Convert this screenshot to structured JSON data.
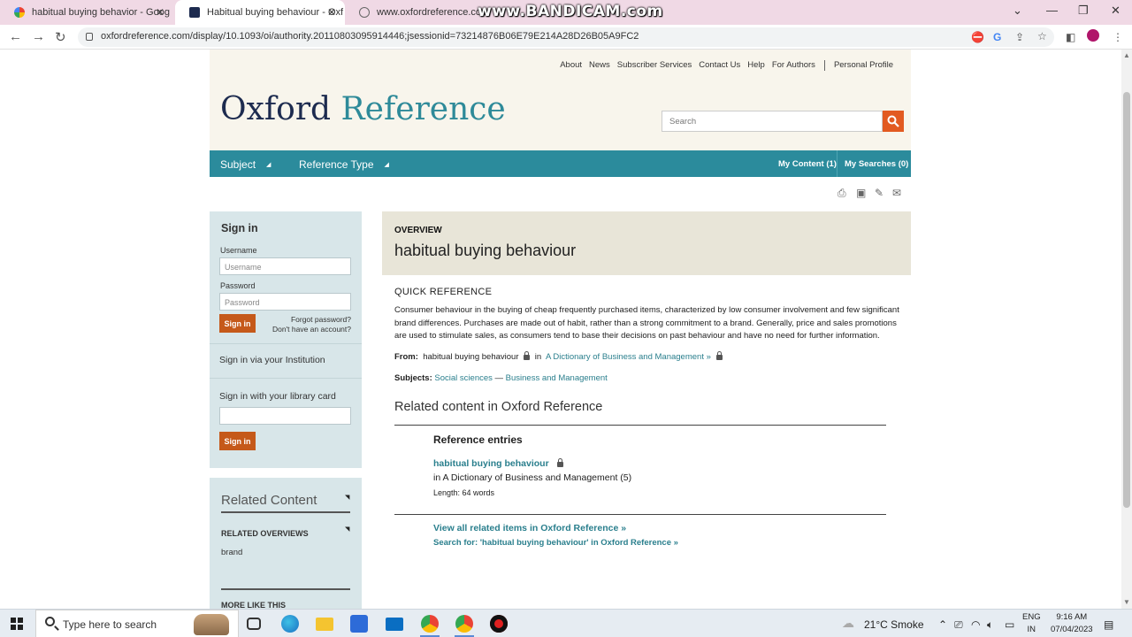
{
  "browser": {
    "tabs": [
      {
        "title": "habitual buying behavior - Goog",
        "favicon": "google-icon"
      },
      {
        "title": "Habitual buying behaviour - Oxf",
        "favicon": "oxford-icon"
      },
      {
        "title": "www.oxfordreference.com",
        "favicon": "globe-icon"
      }
    ],
    "watermark": "www.BANDICAM.com",
    "url": "oxfordreference.com/display/10.1093/oi/authority.20110803095914446;jsessionid=73214876B06E79E214A28D26B05A9FC2"
  },
  "header": {
    "links": [
      "About",
      "News",
      "Subscriber Services",
      "Contact Us",
      "Help",
      "For Authors"
    ],
    "personal_profile": "Personal Profile",
    "logo_part1": "Oxford",
    "logo_part2": "Reference",
    "search_placeholder": "Search"
  },
  "nav": {
    "subject": "Subject",
    "reference_type": "Reference Type",
    "my_content": "My Content (1)",
    "my_searches": "My Searches (0)"
  },
  "sidebar": {
    "signin_title": "Sign in",
    "username_label": "Username",
    "username_placeholder": "Username",
    "password_label": "Password",
    "password_placeholder": "Password",
    "signin_button": "Sign in",
    "forgot_password": "Forgot password?",
    "no_account": "Don't have an account?",
    "institution": "Sign in via your Institution",
    "library_card": "Sign in with your library card",
    "library_button": "Sign in",
    "related_content_title": "Related Content",
    "related_overviews": "RELATED OVERVIEWS",
    "related_overview_item": "brand",
    "more_like_this": "MORE LIKE THIS"
  },
  "article": {
    "overview_label": "OVERVIEW",
    "title": "habitual buying behaviour",
    "quick_reference": "QUICK REFERENCE",
    "description": "Consumer behaviour in the buying of cheap frequently purchased items, characterized by low consumer involvement and few significant brand differences. Purchases are made out of habit, rather than a strong commitment to a brand. Generally, price and sales promotions are used to stimulate sales, as consumers tend to base their decisions on past behaviour and have no need for further information.",
    "from_label": "From:",
    "from_entry": "habitual buying behaviour",
    "from_in": "in",
    "from_source": "A Dictionary of Business and Management »",
    "subjects_label": "Subjects:",
    "subject1": "Social sciences",
    "subject_sep": "—",
    "subject2": "Business and Management",
    "related_heading": "Related content in Oxford Reference",
    "reference_entries": "Reference entries",
    "entry_title": "habitual buying behaviour",
    "entry_in": "in A Dictionary of Business and Management (5)",
    "entry_length": "Length: 64 words",
    "view_all": "View all related items in Oxford Reference »",
    "search_for": "Search for: 'habitual buying behaviour' in Oxford Reference »"
  },
  "taskbar": {
    "search_text": "Type here to search",
    "weather": "21°C  Smoke",
    "lang1": "ENG",
    "lang2": "IN",
    "time": "9:16 AM",
    "date": "07/04/2023"
  },
  "colors": {
    "oxford_teal": "#2b8b9c",
    "oxford_navy": "#1d2b4f",
    "sign_in_orange": "#c5591a",
    "search_orange": "#e25a21",
    "sidebar_bg": "#d8e6e9",
    "overview_bg": "#e8e5d8"
  }
}
